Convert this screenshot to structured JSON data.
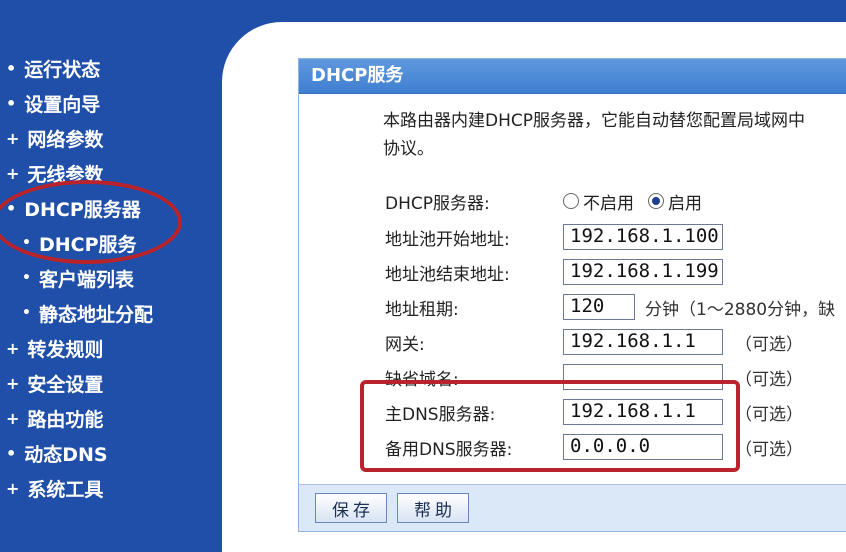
{
  "sidebar": {
    "items": [
      {
        "label": "运行状态"
      },
      {
        "label": "设置向导"
      },
      {
        "label": "网络参数"
      },
      {
        "label": "无线参数"
      },
      {
        "label": "DHCP服务器"
      },
      {
        "label": "DHCP服务"
      },
      {
        "label": "客户端列表"
      },
      {
        "label": "静态地址分配"
      },
      {
        "label": "转发规则"
      },
      {
        "label": "安全设置"
      },
      {
        "label": "路由功能"
      },
      {
        "label": "动态DNS"
      },
      {
        "label": "系统工具"
      }
    ],
    "bullet_main": "•",
    "bullet_sub": "•"
  },
  "panel": {
    "title": "DHCP服务",
    "intro_line1": "本路由器内建DHCP服务器，它能自动替您配置局域网中",
    "intro_line2": "协议。"
  },
  "form": {
    "dhcp_server_label": "DHCP服务器:",
    "radio_disable": "不启用",
    "radio_enable": "启用",
    "pool_start_label": "地址池开始地址:",
    "pool_start_value": "192.168.1.100",
    "pool_end_label": "地址池结束地址:",
    "pool_end_value": "192.168.1.199",
    "lease_label": "地址租期:",
    "lease_value": "120",
    "lease_unit": "分钟（1～2880分钟，缺",
    "gateway_label": "网关:",
    "gateway_value": "192.168.1.1",
    "domain_label": "缺省域名:",
    "domain_value": "",
    "primary_dns_label": "主DNS服务器:",
    "primary_dns_value": "192.168.1.1",
    "secondary_dns_label": "备用DNS服务器:",
    "secondary_dns_value": "0.0.0.0",
    "optional": "（可选）"
  },
  "buttons": {
    "save": "保存",
    "help": "帮助"
  },
  "colors": {
    "sidebar_bg": "#1f4fa8",
    "highlight_red": "#b8232c",
    "title_bar": "#4a88d8"
  }
}
